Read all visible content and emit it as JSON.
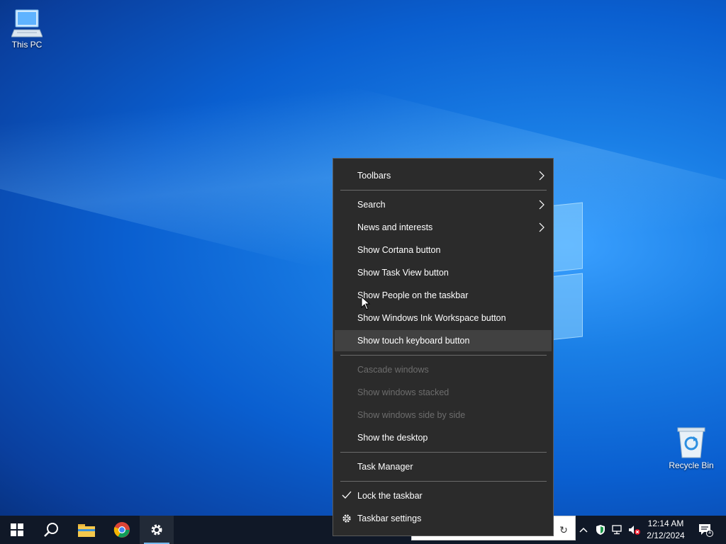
{
  "desktop": {
    "icons": [
      {
        "label": "This PC"
      },
      {
        "label": "Recycle Bin"
      }
    ]
  },
  "context_menu": {
    "toolbars": "Toolbars",
    "search": "Search",
    "news": "News and interests",
    "cortana": "Show Cortana button",
    "task_view": "Show Task View button",
    "people": "Show People on the taskbar",
    "ink": "Show Windows Ink Workspace button",
    "touch_keyboard": "Show touch keyboard button",
    "cascade": "Cascade windows",
    "stacked": "Show windows stacked",
    "side_by_side": "Show windows side by side",
    "show_desktop": "Show the desktop",
    "task_manager": "Task Manager",
    "lock": "Lock the taskbar",
    "settings": "Taskbar settings"
  },
  "taskbar": {
    "time": "12:14 AM",
    "date": "2/12/2024",
    "notification_count": "1",
    "pinned": [
      "start-icon",
      "search-icon",
      "file-explorer-icon",
      "chrome-icon",
      "settings-icon"
    ]
  },
  "colors": {
    "taskbar": "#101827",
    "menu_bg": "#2b2b2b",
    "menu_hover": "#414141",
    "menu_disabled_text": "#6d6d6d",
    "accent": "#76b9ed"
  }
}
